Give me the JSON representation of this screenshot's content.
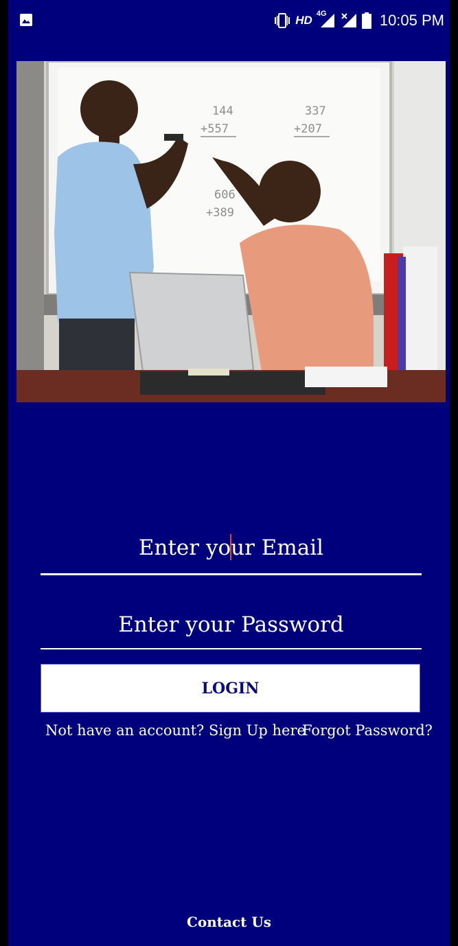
{
  "status_bar": {
    "left_icon": "image-icon",
    "hd_label": "HD",
    "network_label": "4G",
    "time": "10:05 PM"
  },
  "hero": {
    "image_description": "classroom-whiteboard-photo",
    "board_numbers": [
      "144",
      "+557",
      "337",
      "+207",
      "606",
      "+389"
    ]
  },
  "form": {
    "email_placeholder_a": "Enter yo",
    "email_placeholder_b": "ur Email",
    "password_placeholder": "Enter your Password",
    "login_label": "LOGIN",
    "signup_link": "Not have an account? Sign Up here",
    "forgot_link": "Forgot Password?"
  },
  "footer": {
    "contact_label": "Contact Us"
  },
  "colors": {
    "background": "#00007d",
    "button_bg": "#ffffff",
    "button_text": "#0b0b7a",
    "caret": "#e0442a"
  }
}
